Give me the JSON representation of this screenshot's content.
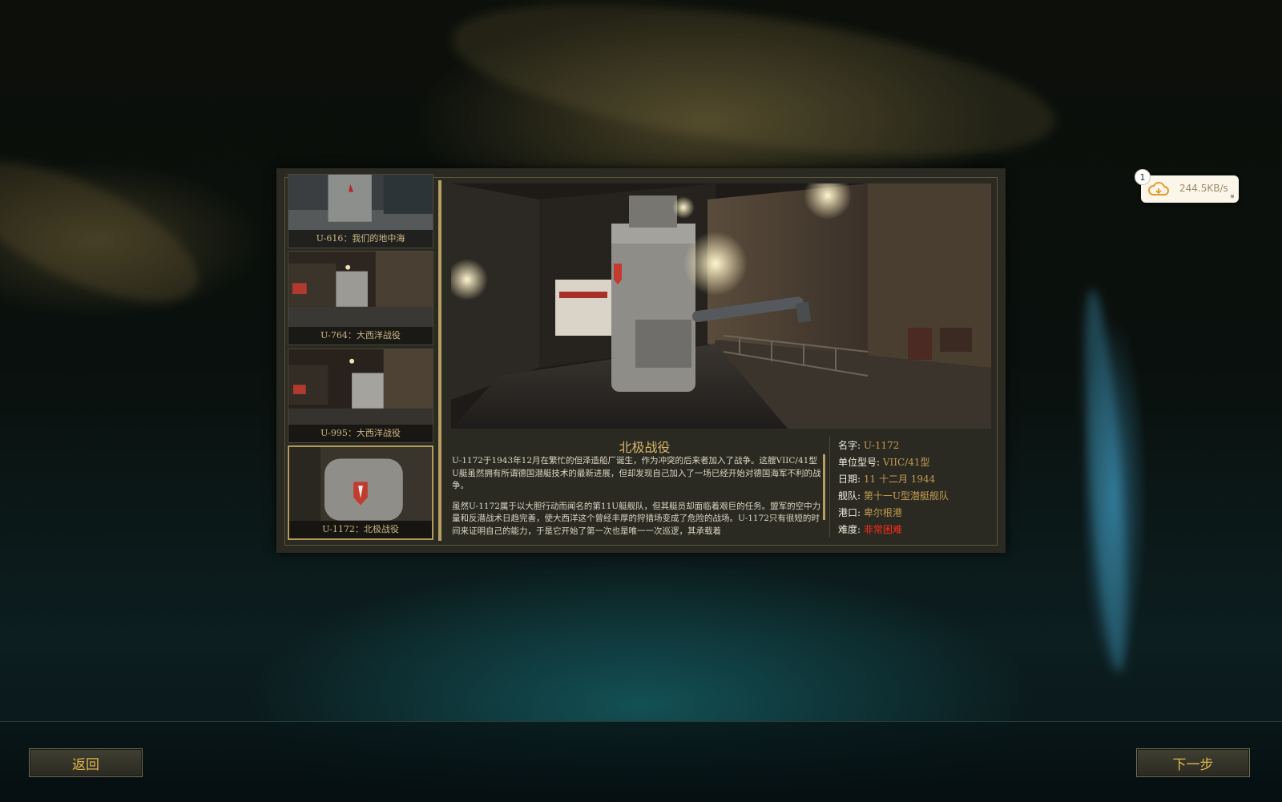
{
  "network": {
    "badge_count": "1",
    "speed": "244.5KB/s",
    "icon": "cloud-icon"
  },
  "missions": [
    {
      "label": "U-616：我们的地中海",
      "selected": false
    },
    {
      "label": "U-764：大西洋战役",
      "selected": false
    },
    {
      "label": "U-995：大西洋战役",
      "selected": false
    },
    {
      "label": "U-1172：北极战役",
      "selected": true
    }
  ],
  "detail": {
    "title": "北极战役",
    "paragraphs": [
      "U-1172于1943年12月在繁忙的但泽造船厂诞生，作为冲突的后来者加入了战争。这艘VIIC/41型U艇虽然拥有所谓德国潜艇技术的最新进展，但却发现自己加入了一场已经开始对德国海军不利的战争。",
      "虽然U-1172属于以大胆行动而闻名的第11U艇舰队，但其艇员却面临着艰巨的任务。盟军的空中力量和反潜战术日趋完善，使大西洋这个曾经丰厚的狩猎场变成了危险的战场。U-1172只有很短的时间来证明自己的能力，于是它开始了第一次也是唯一一次巡逻，其承载着"
    ]
  },
  "info": {
    "name_key": "名字:",
    "name_val": "U-1172",
    "type_key": "单位型号:",
    "type_val": "VIIC/41型",
    "date_key": "日期:",
    "date_val": "11 十二月 1944",
    "fleet_key": "舰队:",
    "fleet_val": "第十一U型潜艇舰队",
    "port_key": "港口:",
    "port_val": "卑尔根港",
    "difficulty_key": "难度:",
    "difficulty_val": "非常困难"
  },
  "colors": {
    "accent_gold": "#c29a52",
    "difficulty_red": "#ff2a1a",
    "button_text": "#e4b74d"
  },
  "buttons": {
    "back": "返回",
    "next": "下一步"
  }
}
